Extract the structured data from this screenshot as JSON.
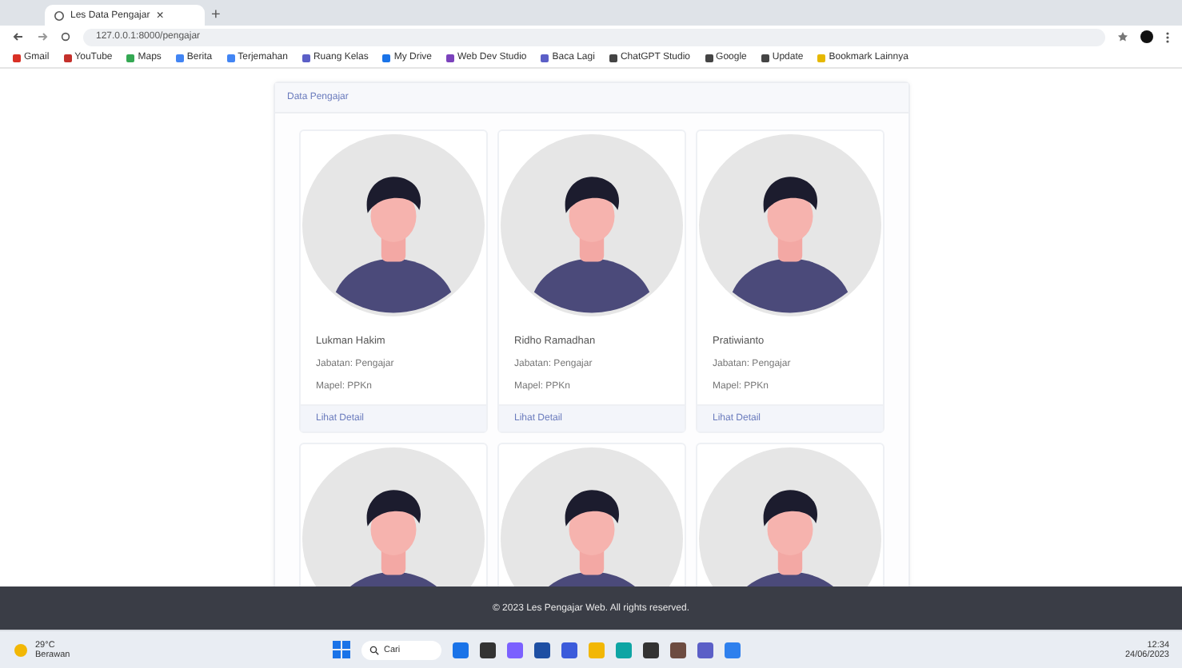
{
  "browser": {
    "tab_title": "Les Data Pengajar",
    "close": "×",
    "new_tab": "+",
    "url": "127.0.0.1:8000/pengajar",
    "bookmarks": [
      {
        "label": "Gmail",
        "color": "#d93025"
      },
      {
        "label": "YouTube",
        "color": "#c4302b"
      },
      {
        "label": "Maps",
        "color": "#34a853"
      },
      {
        "label": "Berita",
        "color": "#4285f4"
      },
      {
        "label": "Terjemahan",
        "color": "#4285f4"
      },
      {
        "label": "Ruang Kelas",
        "color": "#5b5fc7"
      },
      {
        "label": "My Drive",
        "color": "#1a73e8"
      },
      {
        "label": "Web Dev Studio",
        "color": "#7b42bc"
      },
      {
        "label": "Baca Lagi",
        "color": "#5b5fc7"
      },
      {
        "label": "ChatGPT Studio",
        "color": "#444444"
      },
      {
        "label": "Google",
        "color": "#444444"
      },
      {
        "label": "Update",
        "color": "#444444"
      },
      {
        "label": "Bookmark Lainnya",
        "color": "#e6b800"
      }
    ]
  },
  "panel": {
    "title": "Data Pengajar",
    "teachers": [
      {
        "kind": "full",
        "name": "Lukman Hakim",
        "position": "Jabatan: Pengajar",
        "subject": "Mapel: PPKn",
        "link": "Lihat Detail"
      },
      {
        "kind": "full",
        "name": "Ridho Ramadhan",
        "position": "Jabatan: Pengajar",
        "subject": "Mapel: PPKn",
        "link": "Lihat Detail"
      },
      {
        "kind": "full",
        "name": "Pratiwianto",
        "position": "Jabatan: Pengajar",
        "subject": "Mapel: PPKn",
        "link": "Lihat Detail"
      },
      {
        "kind": "cut"
      },
      {
        "kind": "cut"
      },
      {
        "kind": "cut"
      }
    ]
  },
  "footer": "© 2023 Les Pengajar Web. All rights reserved.",
  "taskbar": {
    "weather_temp": "29°C",
    "weather_text": "Berawan",
    "search": "Cari",
    "time": "12:34",
    "date": "24/06/2023"
  }
}
